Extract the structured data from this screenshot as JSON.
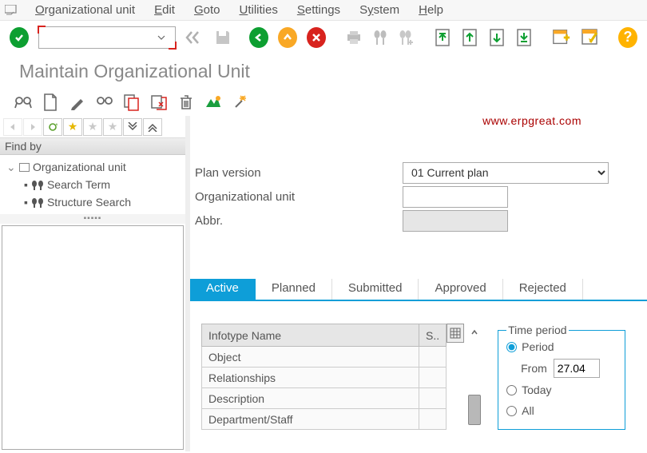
{
  "menubar": {
    "items": [
      {
        "label": "Organizational unit",
        "underline": "O"
      },
      {
        "label": "Edit",
        "underline": "E"
      },
      {
        "label": "Goto",
        "underline": "G"
      },
      {
        "label": "Utilities",
        "underline": "U"
      },
      {
        "label": "Settings",
        "underline": "S"
      },
      {
        "label": "System",
        "underline": ""
      },
      {
        "label": "Help",
        "underline": "H"
      }
    ]
  },
  "tcode": {
    "value": ""
  },
  "page_title": "Maintain Organizational Unit",
  "watermark": "www.erpgreat.com",
  "find_by": {
    "label": "Find by",
    "root": "Organizational unit",
    "children": [
      "Search Term",
      "Structure Search"
    ]
  },
  "form": {
    "plan_version": {
      "label": "Plan version",
      "value": "01 Current plan"
    },
    "org_unit": {
      "label": "Organizational unit",
      "value": ""
    },
    "abbr": {
      "label": "Abbr.",
      "value": ""
    }
  },
  "tabs": [
    "Active",
    "Planned",
    "Submitted",
    "Approved",
    "Rejected"
  ],
  "active_tab": "Active",
  "infotype_table": {
    "headers": [
      "Infotype Name",
      "S.."
    ],
    "rows": [
      "Object",
      "Relationships",
      "Description",
      "Department/Staff"
    ]
  },
  "time_period": {
    "legend": "Time period",
    "options": [
      "Period",
      "Today",
      "All"
    ],
    "selected": "Period",
    "from_label": "From",
    "from_value": "27.04"
  }
}
